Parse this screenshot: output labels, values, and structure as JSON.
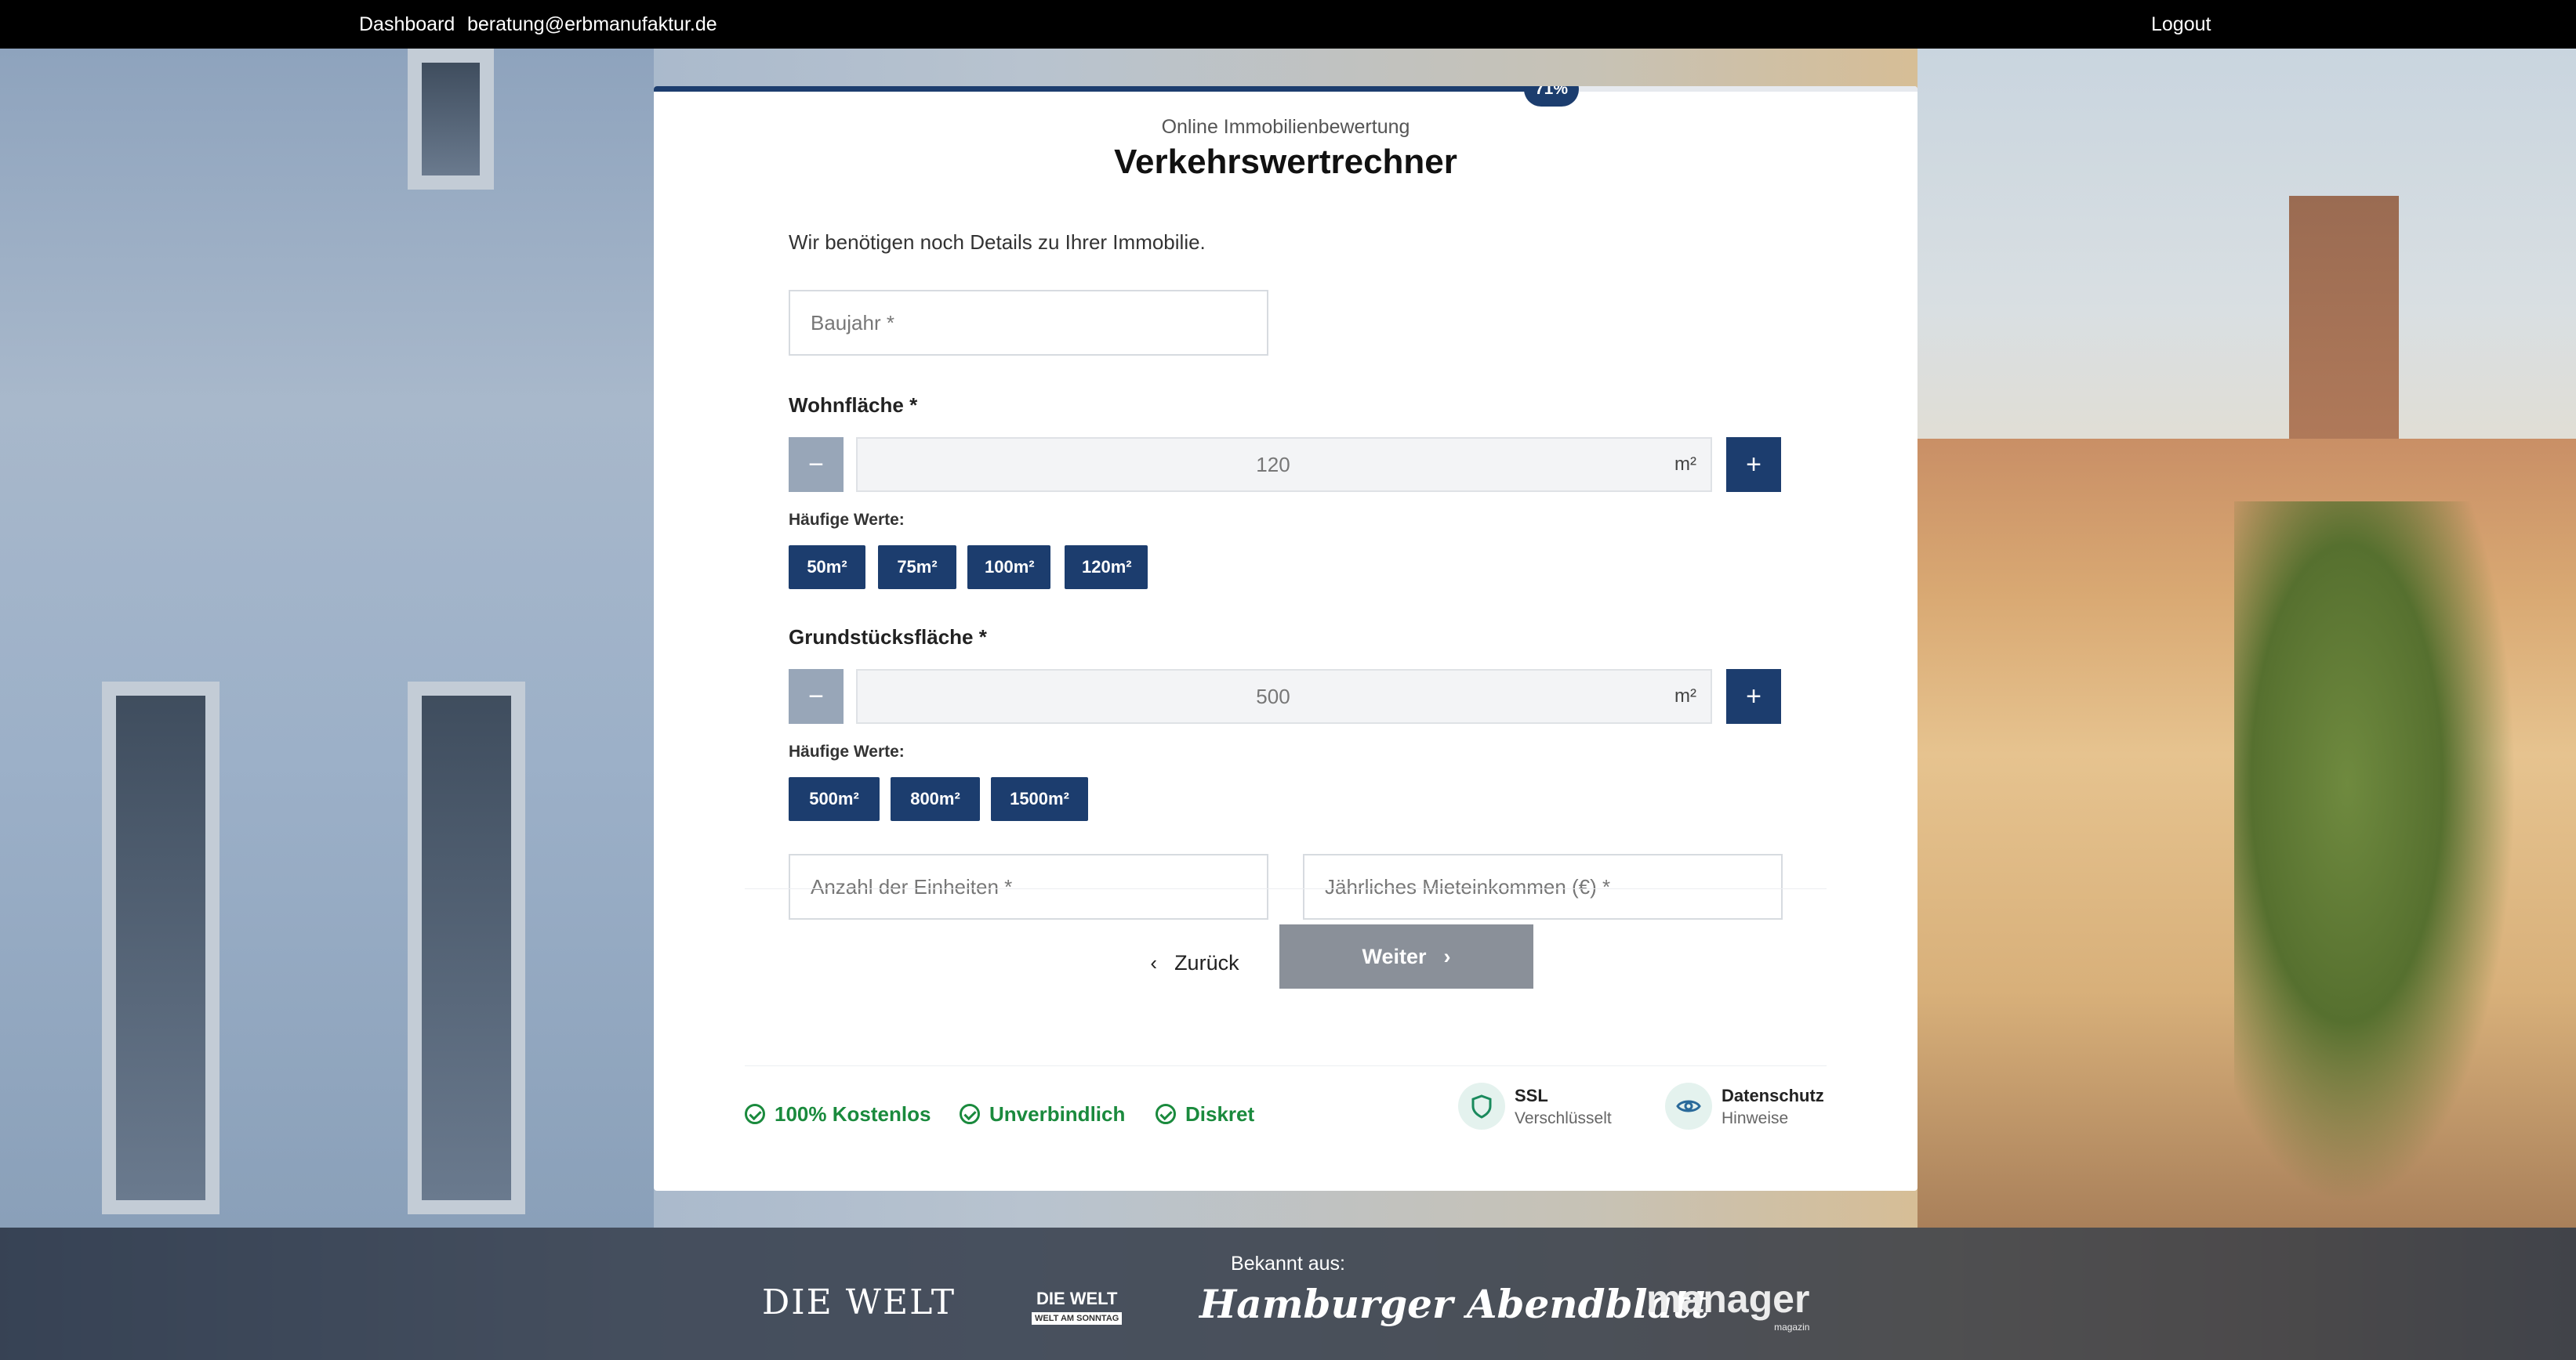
{
  "topbar": {
    "dashboard_label": "Dashboard",
    "email": "beratung@erbmanufaktur.de",
    "logout_label": "Logout"
  },
  "progress": {
    "percent": 71,
    "label": "71%",
    "color": "#1c3d6e"
  },
  "header": {
    "subtitle": "Online Immobilienbewertung",
    "title": "Verkehrswertrechner"
  },
  "form": {
    "intro": "Wir benötigen noch Details zu Ihrer Immobilie.",
    "baujahr_placeholder": "Baujahr *",
    "wohnflaeche": {
      "label": "Wohnfläche *",
      "value": "120",
      "unit": "m²",
      "minus": "−",
      "plus": "+",
      "common_label": "Häufige Werte:",
      "chips": [
        "50m²",
        "75m²",
        "100m²",
        "120m²"
      ]
    },
    "grundstuecksflaeche": {
      "label": "Grundstücksfläche *",
      "value": "500",
      "unit": "m²",
      "minus": "−",
      "plus": "+",
      "common_label": "Häufige Werte:",
      "chips": [
        "500m²",
        "800m²",
        "1500m²"
      ]
    },
    "einheiten_placeholder": "Anzahl der Einheiten *",
    "mieteinkommen_placeholder": "Jährliches Mieteinkommen (€) *"
  },
  "navigation": {
    "back_label": "Zurück",
    "next_label": "Weiter"
  },
  "trust": {
    "items": [
      "100% Kostenlos",
      "Unverbindlich",
      "Diskret"
    ],
    "ssl_title": "SSL",
    "ssl_sub": "Verschlüsselt",
    "privacy_title": "Datenschutz",
    "privacy_sub": "Hinweise"
  },
  "press": {
    "heading": "Bekannt aus:",
    "logo_welt": "DIE WELT",
    "logo_welt_sonntag": "DIE WELT",
    "logo_welt_sonntag_sub": "WELT AM SONNTAG",
    "logo_hamburger": "Hamburger Abendblatt",
    "logo_manager": "manager",
    "logo_manager_sub": "magazin"
  }
}
